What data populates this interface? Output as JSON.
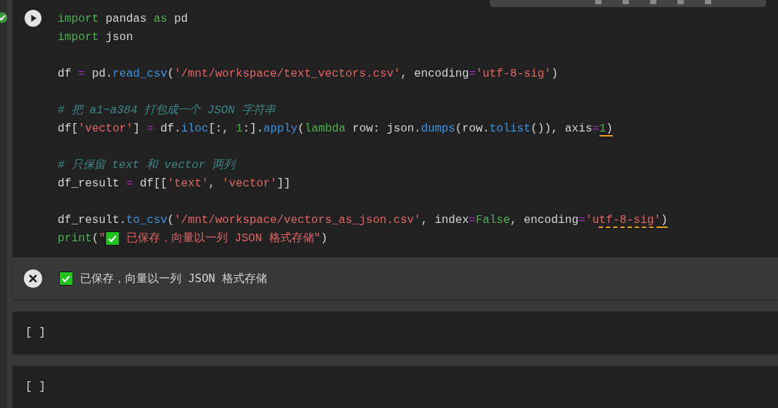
{
  "cells": [
    {
      "kind": "code",
      "lines": [
        {
          "kind": "code",
          "tokens": [
            {
              "kind": "kw",
              "text": "import"
            },
            {
              "kind": "plain",
              "text": " pandas "
            },
            {
              "kind": "kw",
              "text": "as"
            },
            {
              "kind": "plain",
              "text": " pd"
            }
          ]
        },
        {
          "kind": "code",
          "tokens": [
            {
              "kind": "kw",
              "text": "import"
            },
            {
              "kind": "plain",
              "text": " json"
            }
          ]
        },
        {
          "kind": "blank"
        },
        {
          "kind": "code",
          "tokens": [
            {
              "kind": "plain",
              "text": "df "
            },
            {
              "kind": "op",
              "text": "="
            },
            {
              "kind": "plain",
              "text": " pd."
            },
            {
              "kind": "func",
              "text": "read_csv"
            },
            {
              "kind": "plain",
              "text": "("
            },
            {
              "kind": "str",
              "text": "'/mnt/workspace/text_vectors.csv'"
            },
            {
              "kind": "plain",
              "text": ", encoding"
            },
            {
              "kind": "op",
              "text": "="
            },
            {
              "kind": "str",
              "text": "'utf-8-sig'"
            },
            {
              "kind": "plain",
              "text": ")"
            }
          ]
        },
        {
          "kind": "blank"
        },
        {
          "kind": "code",
          "tokens": [
            {
              "kind": "comment",
              "text": "# 把 a1~a384 打包成一个 JSON 字符串"
            }
          ]
        },
        {
          "kind": "code",
          "tokens": [
            {
              "kind": "plain",
              "text": "df["
            },
            {
              "kind": "str",
              "text": "'vector'"
            },
            {
              "kind": "plain",
              "text": "] "
            },
            {
              "kind": "op",
              "text": "="
            },
            {
              "kind": "plain",
              "text": " df."
            },
            {
              "kind": "func",
              "text": "iloc"
            },
            {
              "kind": "plain",
              "text": "[:, "
            },
            {
              "kind": "num",
              "text": "1"
            },
            {
              "kind": "plain",
              "text": ":]."
            },
            {
              "kind": "func",
              "text": "apply"
            },
            {
              "kind": "plain",
              "text": "("
            },
            {
              "kind": "kw",
              "text": "lambda"
            },
            {
              "kind": "plain",
              "text": " row: json."
            },
            {
              "kind": "func",
              "text": "dumps"
            },
            {
              "kind": "plain",
              "text": "(row."
            },
            {
              "kind": "func",
              "text": "tolist"
            },
            {
              "kind": "plain",
              "text": "()), axis"
            },
            {
              "kind": "op",
              "text": "="
            },
            {
              "kind": "num",
              "text": "1",
              "warning": true
            },
            {
              "kind": "plain",
              "text": ")",
              "warning": true
            }
          ]
        },
        {
          "kind": "blank"
        },
        {
          "kind": "code",
          "tokens": [
            {
              "kind": "comment",
              "text": "# 只保留 text 和 vector 两列"
            }
          ]
        },
        {
          "kind": "code",
          "tokens": [
            {
              "kind": "plain",
              "text": "df_result "
            },
            {
              "kind": "op",
              "text": "="
            },
            {
              "kind": "plain",
              "text": " df[["
            },
            {
              "kind": "str",
              "text": "'text'"
            },
            {
              "kind": "plain",
              "text": ", "
            },
            {
              "kind": "str",
              "text": "'vector'"
            },
            {
              "kind": "plain",
              "text": "]]"
            }
          ]
        },
        {
          "kind": "blank"
        },
        {
          "kind": "code",
          "tokens": [
            {
              "kind": "plain",
              "text": "df_result."
            },
            {
              "kind": "func",
              "text": "to_csv"
            },
            {
              "kind": "plain",
              "text": "("
            },
            {
              "kind": "str",
              "text": "'/mnt/workspace/vectors_as_json.csv'"
            },
            {
              "kind": "plain",
              "text": ", index"
            },
            {
              "kind": "op",
              "text": "="
            },
            {
              "kind": "kw",
              "text": "False"
            },
            {
              "kind": "plain",
              "text": ", encoding"
            },
            {
              "kind": "op",
              "text": "="
            },
            {
              "kind": "str",
              "text": "'u"
            },
            {
              "kind": "str",
              "text": "tf-8-sig'",
              "warning": true
            },
            {
              "kind": "plain",
              "text": ")",
              "warning": true
            }
          ]
        },
        {
          "kind": "code",
          "tokens": [
            {
              "kind": "kw",
              "text": "print"
            },
            {
              "kind": "plain",
              "text": "("
            },
            {
              "kind": "str",
              "text": "\""
            },
            {
              "kind": "check-emoji"
            },
            {
              "kind": "str",
              "text": " 已保存，向量以一列 JSON 格式存储\""
            },
            {
              "kind": "plain",
              "text": ")"
            }
          ]
        }
      ],
      "output": {
        "error": true,
        "tokens": [
          {
            "kind": "check-emoji"
          },
          {
            "kind": "plain",
            "text": "已保存，向量以一列 JSON 格式存储"
          }
        ]
      }
    },
    {
      "kind": "empty",
      "prompt": "[ ]"
    },
    {
      "kind": "empty",
      "prompt": "[ ]"
    }
  ]
}
